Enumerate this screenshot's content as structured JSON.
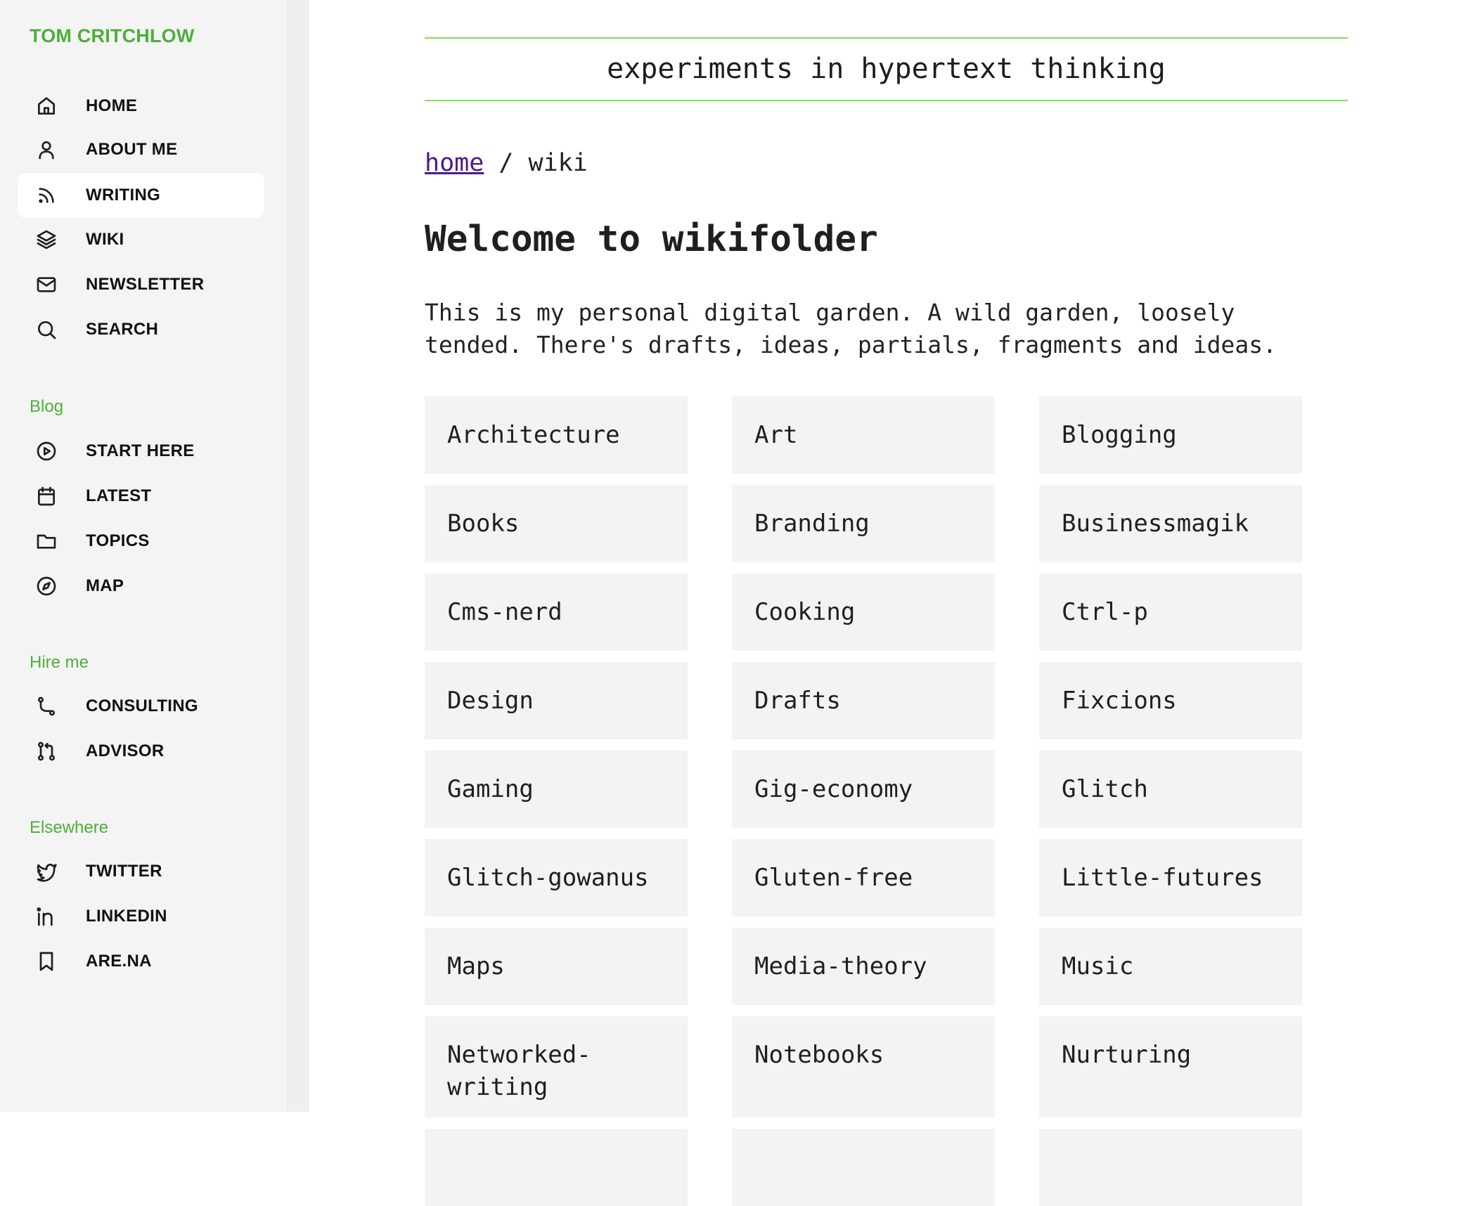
{
  "sidebar": {
    "brand": "TOM CRITCHLOW",
    "main_nav": [
      {
        "label": "HOME",
        "icon": "home-icon"
      },
      {
        "label": "ABOUT ME",
        "icon": "user-icon"
      },
      {
        "label": "WRITING",
        "icon": "rss-icon",
        "active": true
      },
      {
        "label": "WIKI",
        "icon": "layers-icon"
      },
      {
        "label": "NEWSLETTER",
        "icon": "mail-icon"
      },
      {
        "label": "SEARCH",
        "icon": "search-icon"
      }
    ],
    "blog": {
      "title": "Blog",
      "items": [
        {
          "label": "START HERE",
          "icon": "play-circle-icon"
        },
        {
          "label": "LATEST",
          "icon": "calendar-icon"
        },
        {
          "label": "TOPICS",
          "icon": "folder-icon"
        },
        {
          "label": "MAP",
          "icon": "compass-icon"
        }
      ]
    },
    "hire": {
      "title": "Hire me",
      "items": [
        {
          "label": "CONSULTING",
          "icon": "route-icon"
        },
        {
          "label": "ADVISOR",
          "icon": "git-pull-request-icon"
        }
      ]
    },
    "elsewhere": {
      "title": "Elsewhere",
      "items": [
        {
          "label": "TWITTER",
          "icon": "twitter-icon"
        },
        {
          "label": "LINKEDIN",
          "icon": "linkedin-icon"
        },
        {
          "label": "ARE.NA",
          "icon": "bookmark-icon"
        }
      ]
    }
  },
  "main": {
    "tagline": "experiments in hypertext thinking",
    "breadcrumb": {
      "home": "home",
      "separator": " / ",
      "current": "wiki"
    },
    "title": "Welcome to wikifolder",
    "intro": "This is my personal digital garden. A wild garden, loosely tended. There's drafts, ideas, partials, fragments and ideas.",
    "tiles": [
      "Architecture",
      "Art",
      "Blogging",
      "Books",
      "Branding",
      "Businessmagik",
      "Cms-nerd",
      "Cooking",
      "Ctrl-p",
      "Design",
      "Drafts",
      "Fixcions",
      "Gaming",
      "Gig-economy",
      "Glitch",
      "Glitch-gowanus",
      "Gluten-free",
      "Little-futures",
      "Maps",
      "Media-theory",
      "Music",
      "Networked-writing",
      "Notebooks",
      "Nurturing",
      "",
      "",
      ""
    ]
  },
  "colors": {
    "accent_green": "#4caf39",
    "tagline_rule": "#7be35a",
    "link_purple": "#4b1a8a",
    "tile_bg": "#f3f3f3",
    "sidebar_bg": "#f4f4f4"
  }
}
